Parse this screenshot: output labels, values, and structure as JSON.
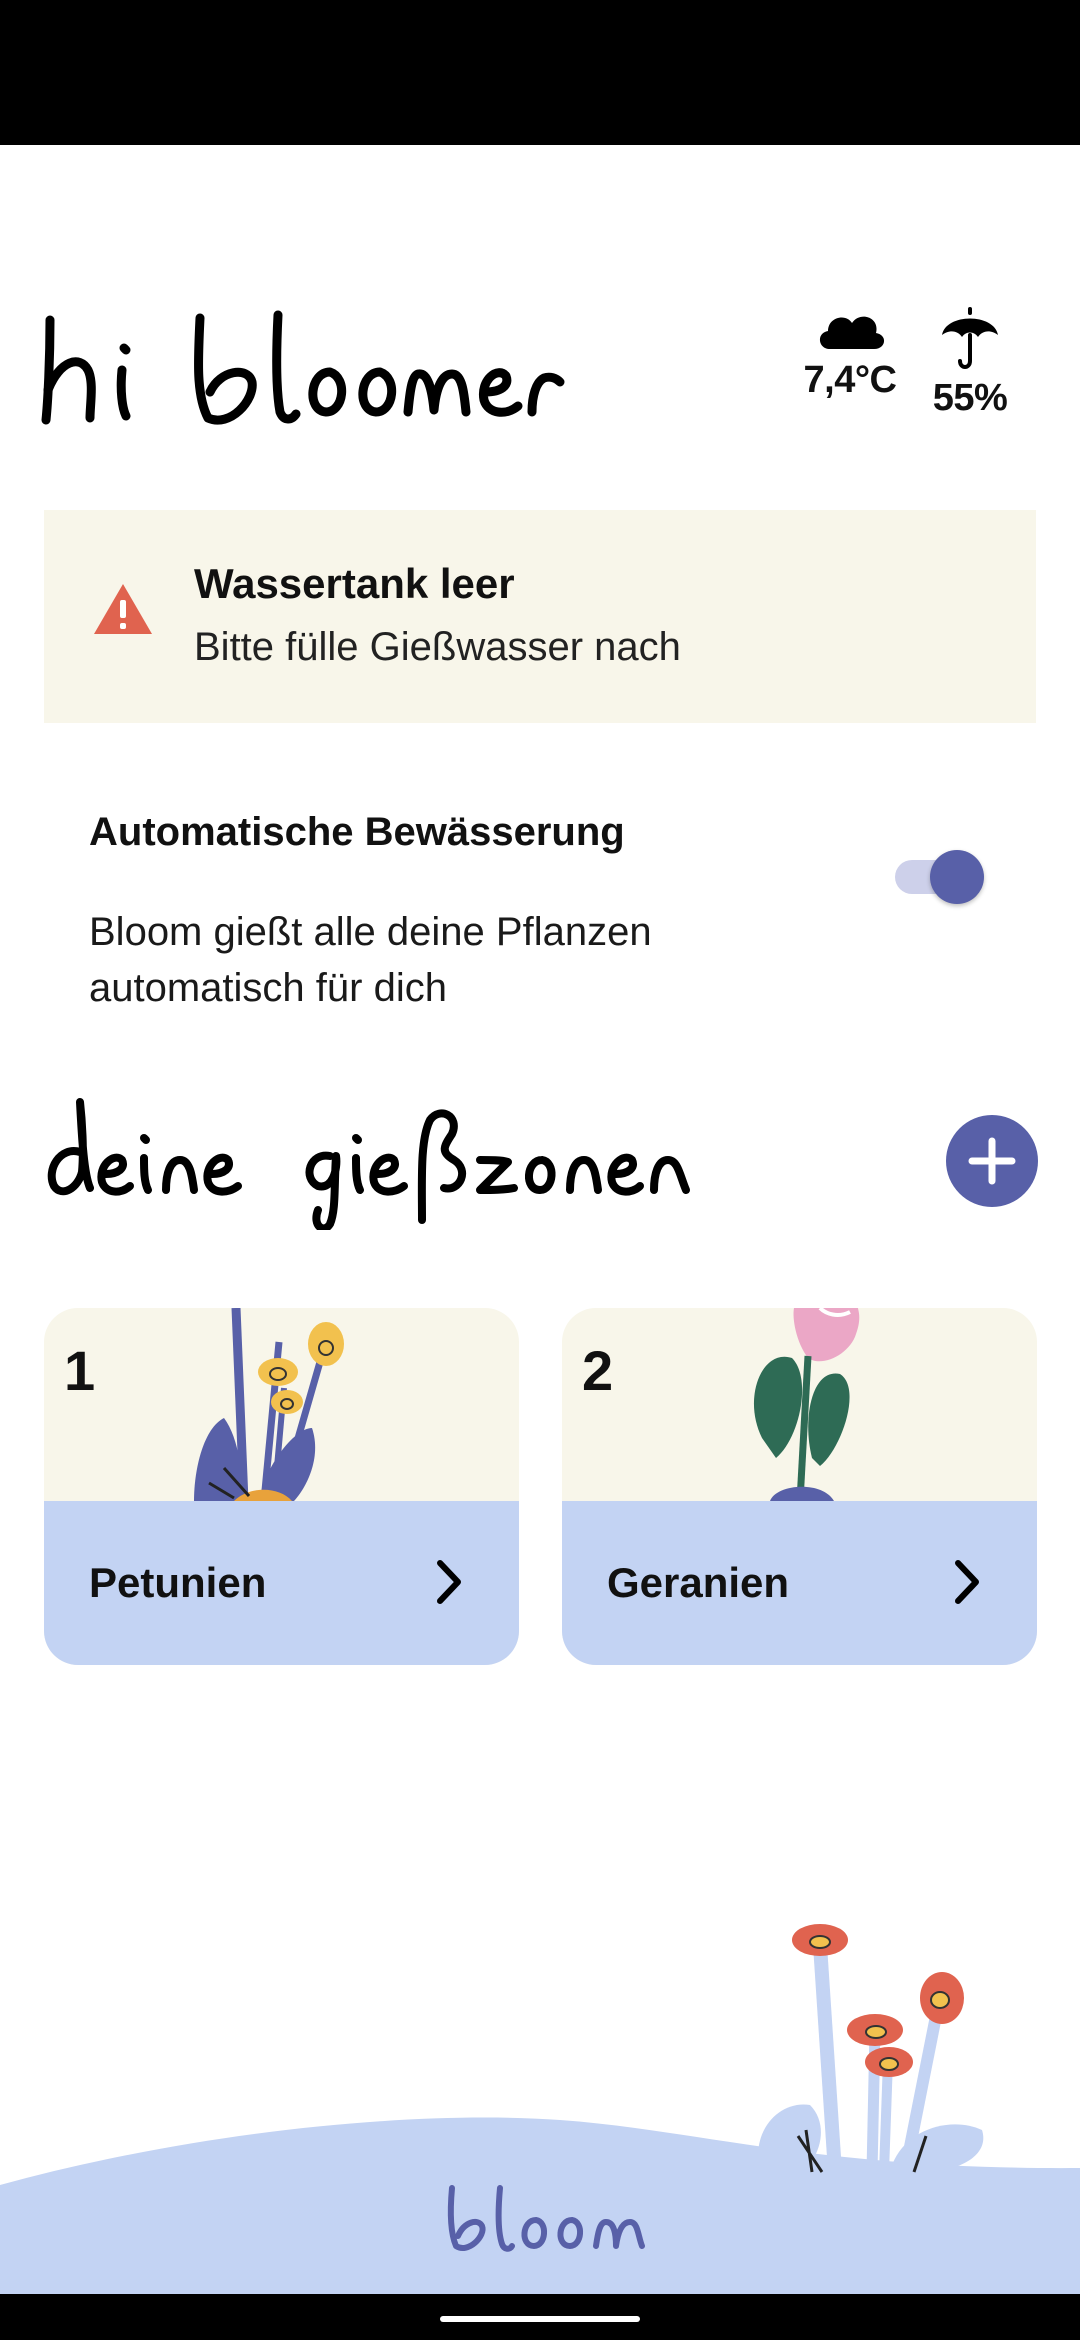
{
  "header": {
    "greeting": "hi bloomer",
    "temperature": "7,4°C",
    "humidity": "55%",
    "temperature_icon": "cloud-icon",
    "humidity_icon": "umbrella-icon"
  },
  "alert": {
    "icon": "warning-triangle-icon",
    "title": "Wassertank leer",
    "message": "Bitte fülle Gießwasser nach"
  },
  "auto_watering": {
    "title": "Automatische Bewässerung",
    "description": "Bloom gießt alle deine Pflanzen automatisch für dich",
    "enabled": true
  },
  "zones": {
    "heading": "deine gießzonen",
    "add_icon": "plus-icon",
    "items": [
      {
        "number": "1",
        "name": "Petunien",
        "icon": "chevron-right-icon"
      },
      {
        "number": "2",
        "name": "Geranien",
        "icon": "chevron-right-icon"
      }
    ]
  },
  "brand": {
    "name": "bloom"
  },
  "colors": {
    "accent": "#5860a8",
    "card_bg": "#f8f6ea",
    "zone_footer": "#c3d3f3",
    "alert": "#e0634f",
    "ground": "#c3d3f3"
  }
}
